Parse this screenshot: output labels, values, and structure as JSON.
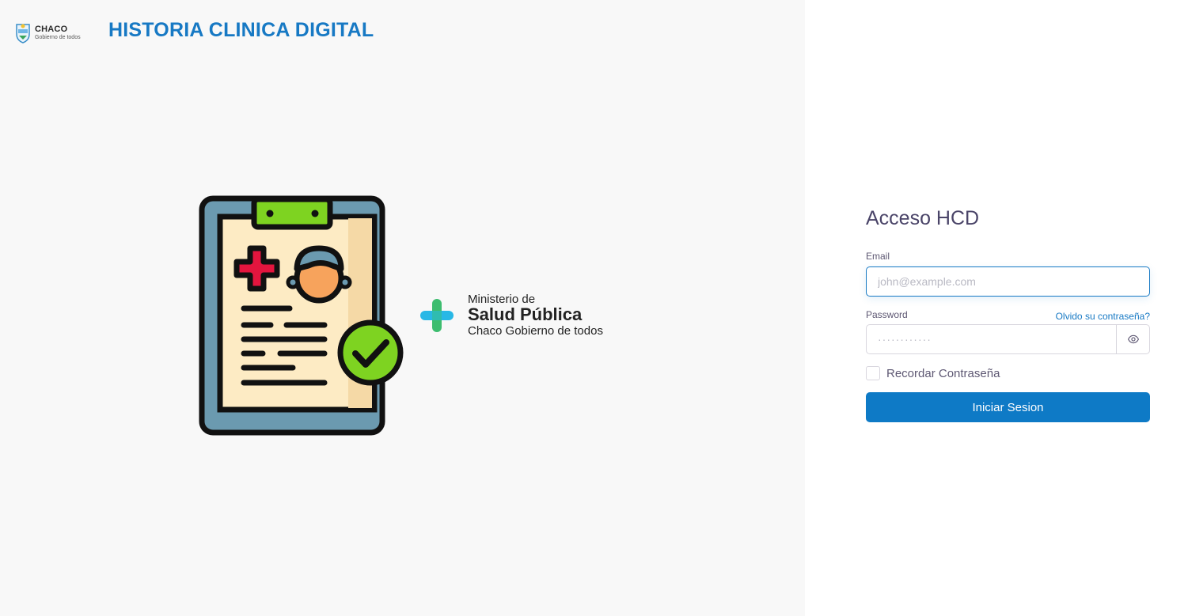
{
  "header": {
    "logo_main": "CHACO",
    "logo_sub": "Gobierno de todos",
    "app_title": "HISTORIA CLINICA DIGITAL"
  },
  "ministry": {
    "line1": "Ministerio de",
    "line2": "Salud Pública",
    "line3": "Chaco Gobierno de todos"
  },
  "login": {
    "title": "Acceso HCD",
    "email_label": "Email",
    "email_placeholder": "john@example.com",
    "password_label": "Password",
    "forgot_link": "Olvido su contraseña?",
    "password_placeholder": "············",
    "remember_label": "Recordar Contraseña",
    "submit_label": "Iniciar Sesion"
  },
  "icons": {
    "brand": "chaco-seal-icon",
    "illustration": "clipboard-patient-check-icon",
    "ministry": "health-plus-icon",
    "password_toggle": "eye-icon"
  },
  "colors": {
    "accent": "#1779c4",
    "button": "#0e7ac6",
    "heading": "#4a4468",
    "left_background": "#f8f8f8"
  }
}
